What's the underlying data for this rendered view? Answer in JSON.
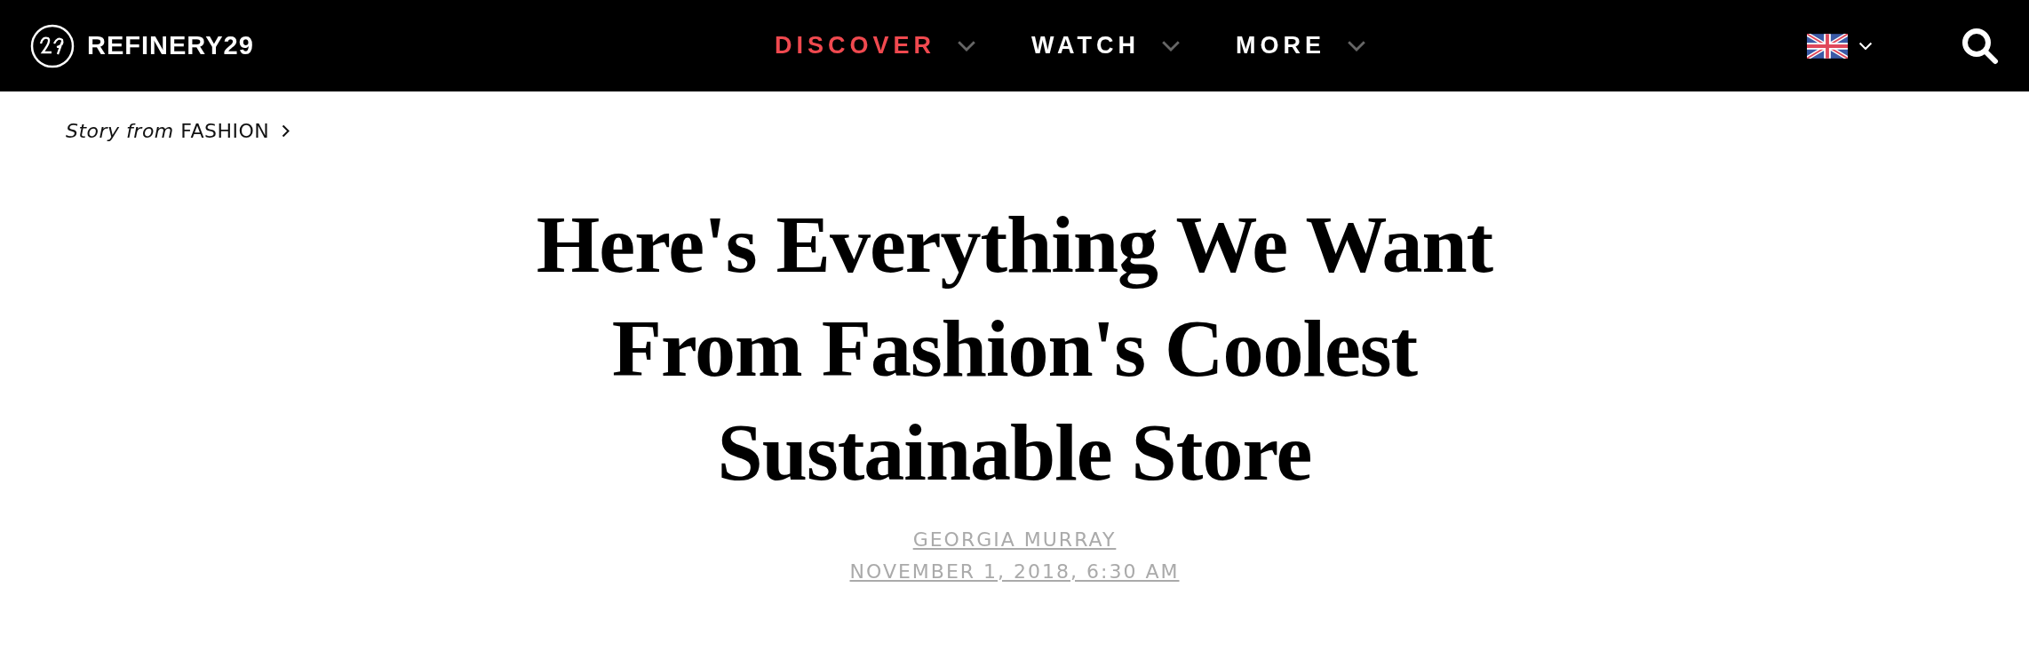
{
  "header": {
    "logo_text": "REFINERY29",
    "nav": [
      {
        "label": "DISCOVER",
        "selected": true
      },
      {
        "label": "WATCH",
        "selected": false
      },
      {
        "label": "MORE",
        "selected": false
      }
    ]
  },
  "breadcrumb": "*Story from* FASHION",
  "article": {
    "title": "Here's Everything We Want From Fashion's Coolest Sustainable Store",
    "author": "GEORGIA MURRAY",
    "date": "NOVEMBER 1, 2018, 6:30 AM"
  }
}
